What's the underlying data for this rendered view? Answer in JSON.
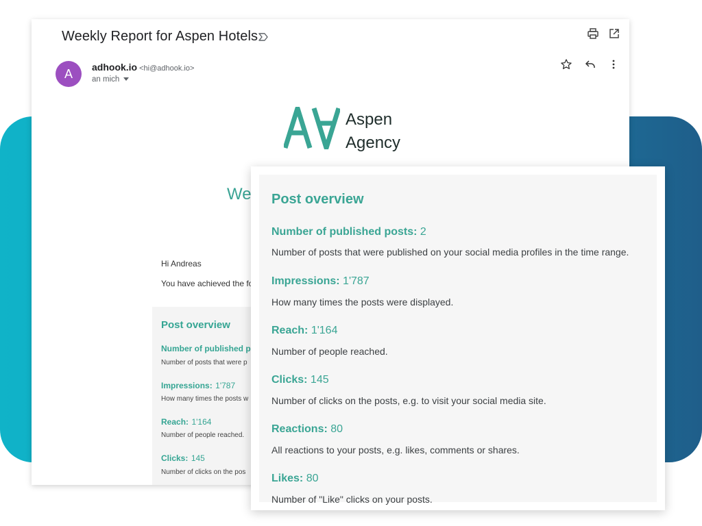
{
  "email": {
    "subject": "Weekly Report for Aspen Hotels",
    "sender_initial": "A",
    "sender_name": "adhook.io",
    "sender_email": "<hi@adhook.io>",
    "recipient": "an mich",
    "logo_line1": "Aspen",
    "logo_line2": "Agency",
    "heading_partial": "We",
    "greeting": "Hi Andreas",
    "intro_partial": "You have achieved the fo"
  },
  "small_panel": {
    "title": "Post overview",
    "items": [
      {
        "label": "Number of published p",
        "value": "",
        "desc": "Number of posts that were p"
      },
      {
        "label": "Impressions:",
        "value": "1'787",
        "desc": "How many times the posts w"
      },
      {
        "label": "Reach:",
        "value": "1'164",
        "desc": "Number of people reached."
      },
      {
        "label": "Clicks:",
        "value": "145",
        "desc": "Number of clicks on the pos"
      }
    ]
  },
  "overview": {
    "title": "Post overview",
    "items": [
      {
        "label": "Number of published posts:",
        "value": "2",
        "desc": "Number of posts that were published on your social media profiles in the time range."
      },
      {
        "label": "Impressions:",
        "value": "1'787",
        "desc": "How many times the posts were displayed."
      },
      {
        "label": "Reach:",
        "value": "1'164",
        "desc": "Number of people reached."
      },
      {
        "label": "Clicks:",
        "value": "145",
        "desc": "Number of clicks on the posts, e.g. to visit your social media site."
      },
      {
        "label": "Reactions:",
        "value": "80",
        "desc": "All reactions to your posts, e.g. likes, comments or shares."
      },
      {
        "label": "Likes:",
        "value": "80",
        "desc": "Number of \"Like\" clicks on your posts."
      }
    ]
  },
  "icons": {
    "label": "label-icon",
    "print": "print-icon",
    "open_new": "open-in-new-window-icon",
    "star": "star-icon",
    "reply": "reply-icon",
    "more": "more-vert-icon"
  },
  "colors": {
    "accent": "#3aa594",
    "avatar": "#9c4fc0",
    "band_start": "#10b3c8",
    "band_end": "#1f5e8a"
  }
}
